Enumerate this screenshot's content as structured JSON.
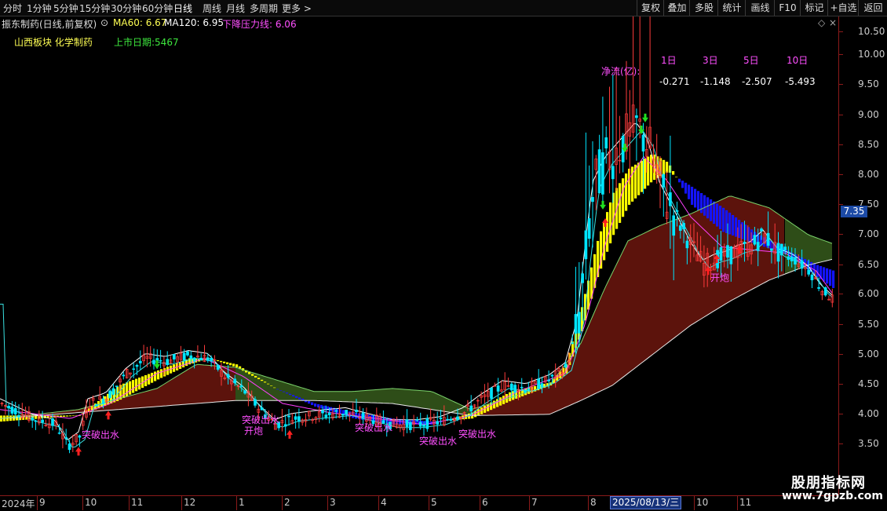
{
  "toolbar": {
    "periods": [
      "分时",
      "1分钟",
      "5分钟",
      "15分钟",
      "30分钟",
      "60分钟",
      "日线",
      "周线",
      "月线",
      "多周期",
      "更多 >"
    ],
    "active_period": "日线",
    "right_buttons": [
      "复权",
      "叠加",
      "多股",
      "统计",
      "画线",
      "F10",
      "标记",
      "+自选",
      "返回"
    ]
  },
  "info": {
    "stock": "振东制药(日线,前复权)",
    "ma60": "MA60: 6.67",
    "ma120": "MA120: 6.95",
    "pressure": "下降压力线: 6.06"
  },
  "sector": "山西板块  化学制药",
  "ipo": "上市日期:5467",
  "flow": {
    "label": "净流(亿):",
    "headers": [
      "1日",
      "3日",
      "5日",
      "10日"
    ],
    "values": [
      "-0.271",
      "-1.148",
      "-2.507",
      "-5.493"
    ]
  },
  "yaxis": {
    "labels": [
      "10.50",
      "10.00",
      "9.50",
      "9.00",
      "8.50",
      "8.00",
      "7.50",
      "7.00",
      "6.50",
      "6.00",
      "5.50",
      "5.00",
      "4.50",
      "4.00",
      "3.50"
    ],
    "current_price": "7.35"
  },
  "xaxis": {
    "labels": [
      "2024年",
      "9",
      "10",
      "11",
      "12",
      "1",
      "2",
      "3",
      "4",
      "5",
      "6",
      "7",
      "8",
      "10",
      "11"
    ],
    "cursor_date": "2025/08/13/三"
  },
  "annotations": [
    "突破出水",
    "开炮",
    "突破出水",
    "突破出水",
    "突破出水",
    "突破出水",
    "开炮"
  ],
  "colors": {
    "up": "#ff3b3b",
    "down": "#00e5ff",
    "fill_yellow": "#ffff00",
    "fill_blue": "#1414ff",
    "fill_brown": "#5c130c",
    "fill_green": "#2e4d18",
    "label_magenta": "#ff4fff"
  },
  "watermark": {
    "line1": "股朋指标网",
    "line2": "www.7gpzb.com"
  }
}
